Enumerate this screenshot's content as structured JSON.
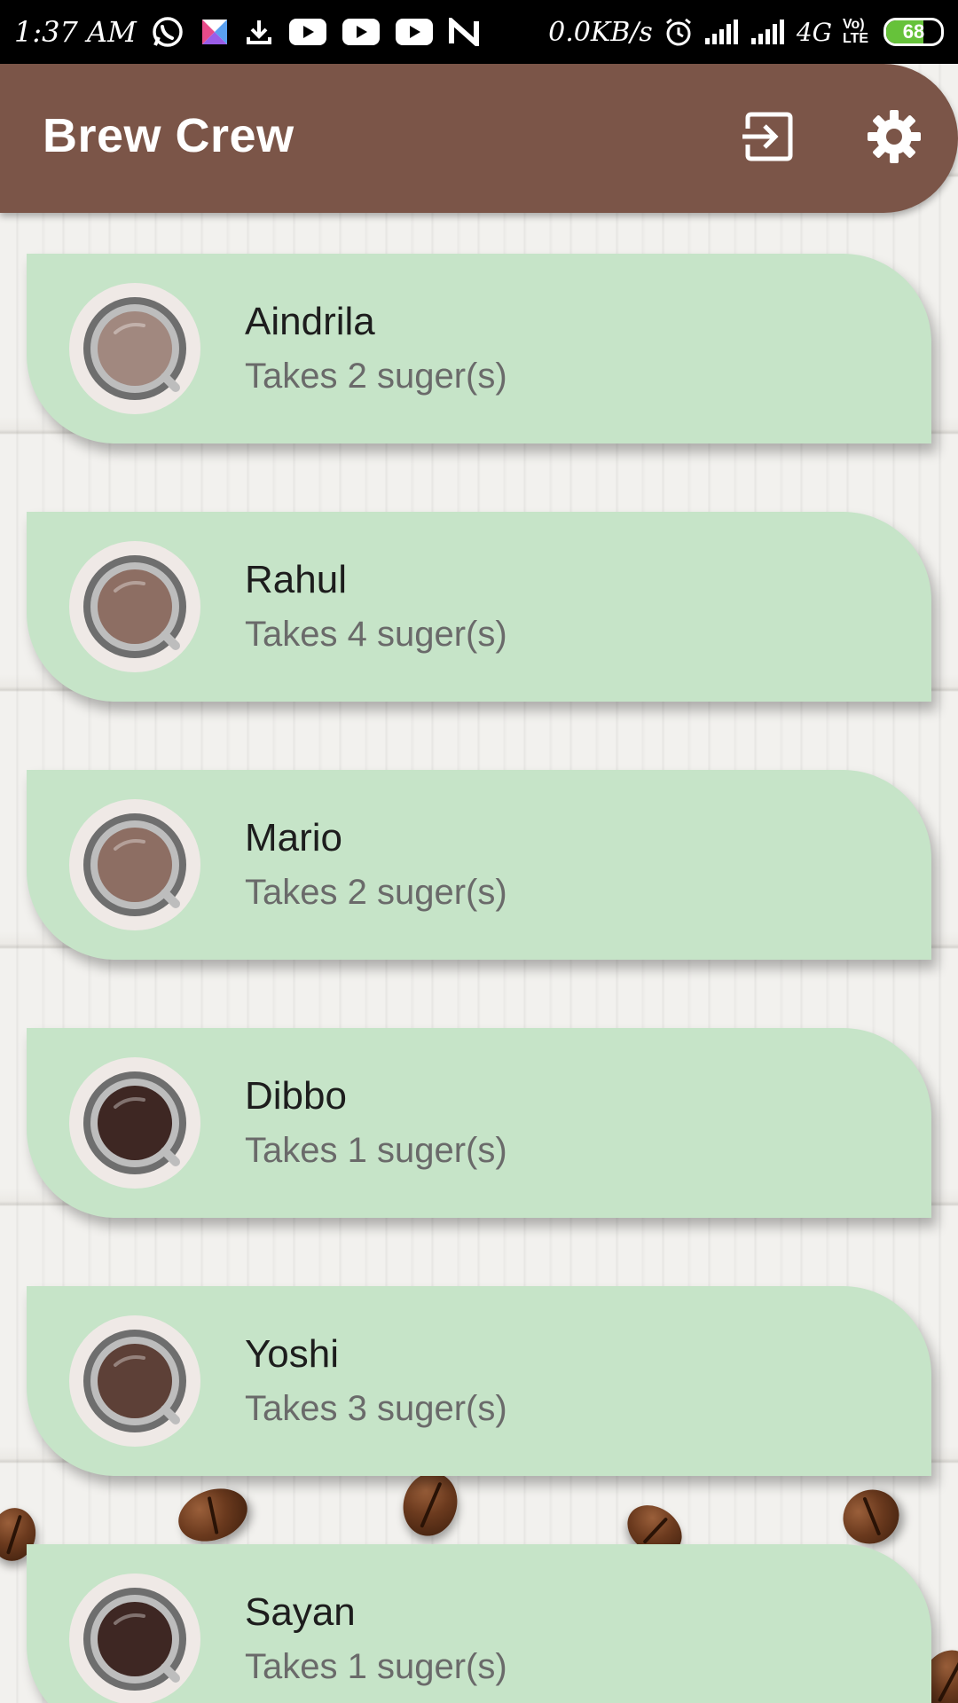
{
  "status_bar": {
    "time": "1:37 AM",
    "speed": "0.0KB/s",
    "network": "4G",
    "volte": "Vo) LTE",
    "battery": "68",
    "battery_level": 0.68,
    "icons": [
      "whatsapp-icon",
      "gallery-icon",
      "download-icon",
      "youtube-icon",
      "youtube-icon",
      "youtube-icon",
      "n-app-icon",
      "alarm-icon",
      "signal-icon",
      "signal-icon"
    ]
  },
  "app_bar": {
    "title": "Brew Crew",
    "actions": [
      "logout-icon",
      "settings-icon"
    ],
    "color": "#7b5548"
  },
  "brews": [
    {
      "name": "Aindrila",
      "subtitle": "Takes 2 suger(s)",
      "cup_color": "#a1887f"
    },
    {
      "name": "Rahul",
      "subtitle": "Takes 4 suger(s)",
      "cup_color": "#8d6e63"
    },
    {
      "name": "Mario",
      "subtitle": "Takes 2 suger(s)",
      "cup_color": "#8d6e63"
    },
    {
      "name": "Dibbo",
      "subtitle": "Takes 1 suger(s)",
      "cup_color": "#3e2723"
    },
    {
      "name": "Yoshi",
      "subtitle": "Takes 3 suger(s)",
      "cup_color": "#5d4037"
    },
    {
      "name": "Sayan",
      "subtitle": "Takes 1 suger(s)",
      "cup_color": "#3e2723"
    }
  ],
  "card_color": "#c6e4c8"
}
